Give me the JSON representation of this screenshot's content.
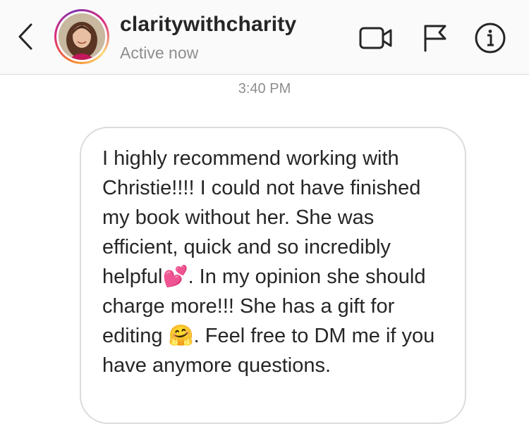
{
  "header": {
    "back_icon": "chevron-left-icon",
    "username": "claritywithcharity",
    "status": "Active now",
    "icons": [
      "video-camera-icon",
      "flag-icon",
      "info-icon"
    ]
  },
  "conversation": {
    "timestamp": "3:40 PM",
    "message": {
      "text": "I highly recommend working with Christie!!!!  I could not have finished my book without her. She was efficient, quick and so incredibly helpful💕. In my opinion she should charge more!!!  She has a gift for editing 🤗.  Feel free to DM me if you have anymore questions."
    }
  },
  "colors": {
    "primary_text": "#262626",
    "secondary_text": "#8e8e8e",
    "border": "#dbdbdb",
    "header_bg": "#fafafa"
  }
}
